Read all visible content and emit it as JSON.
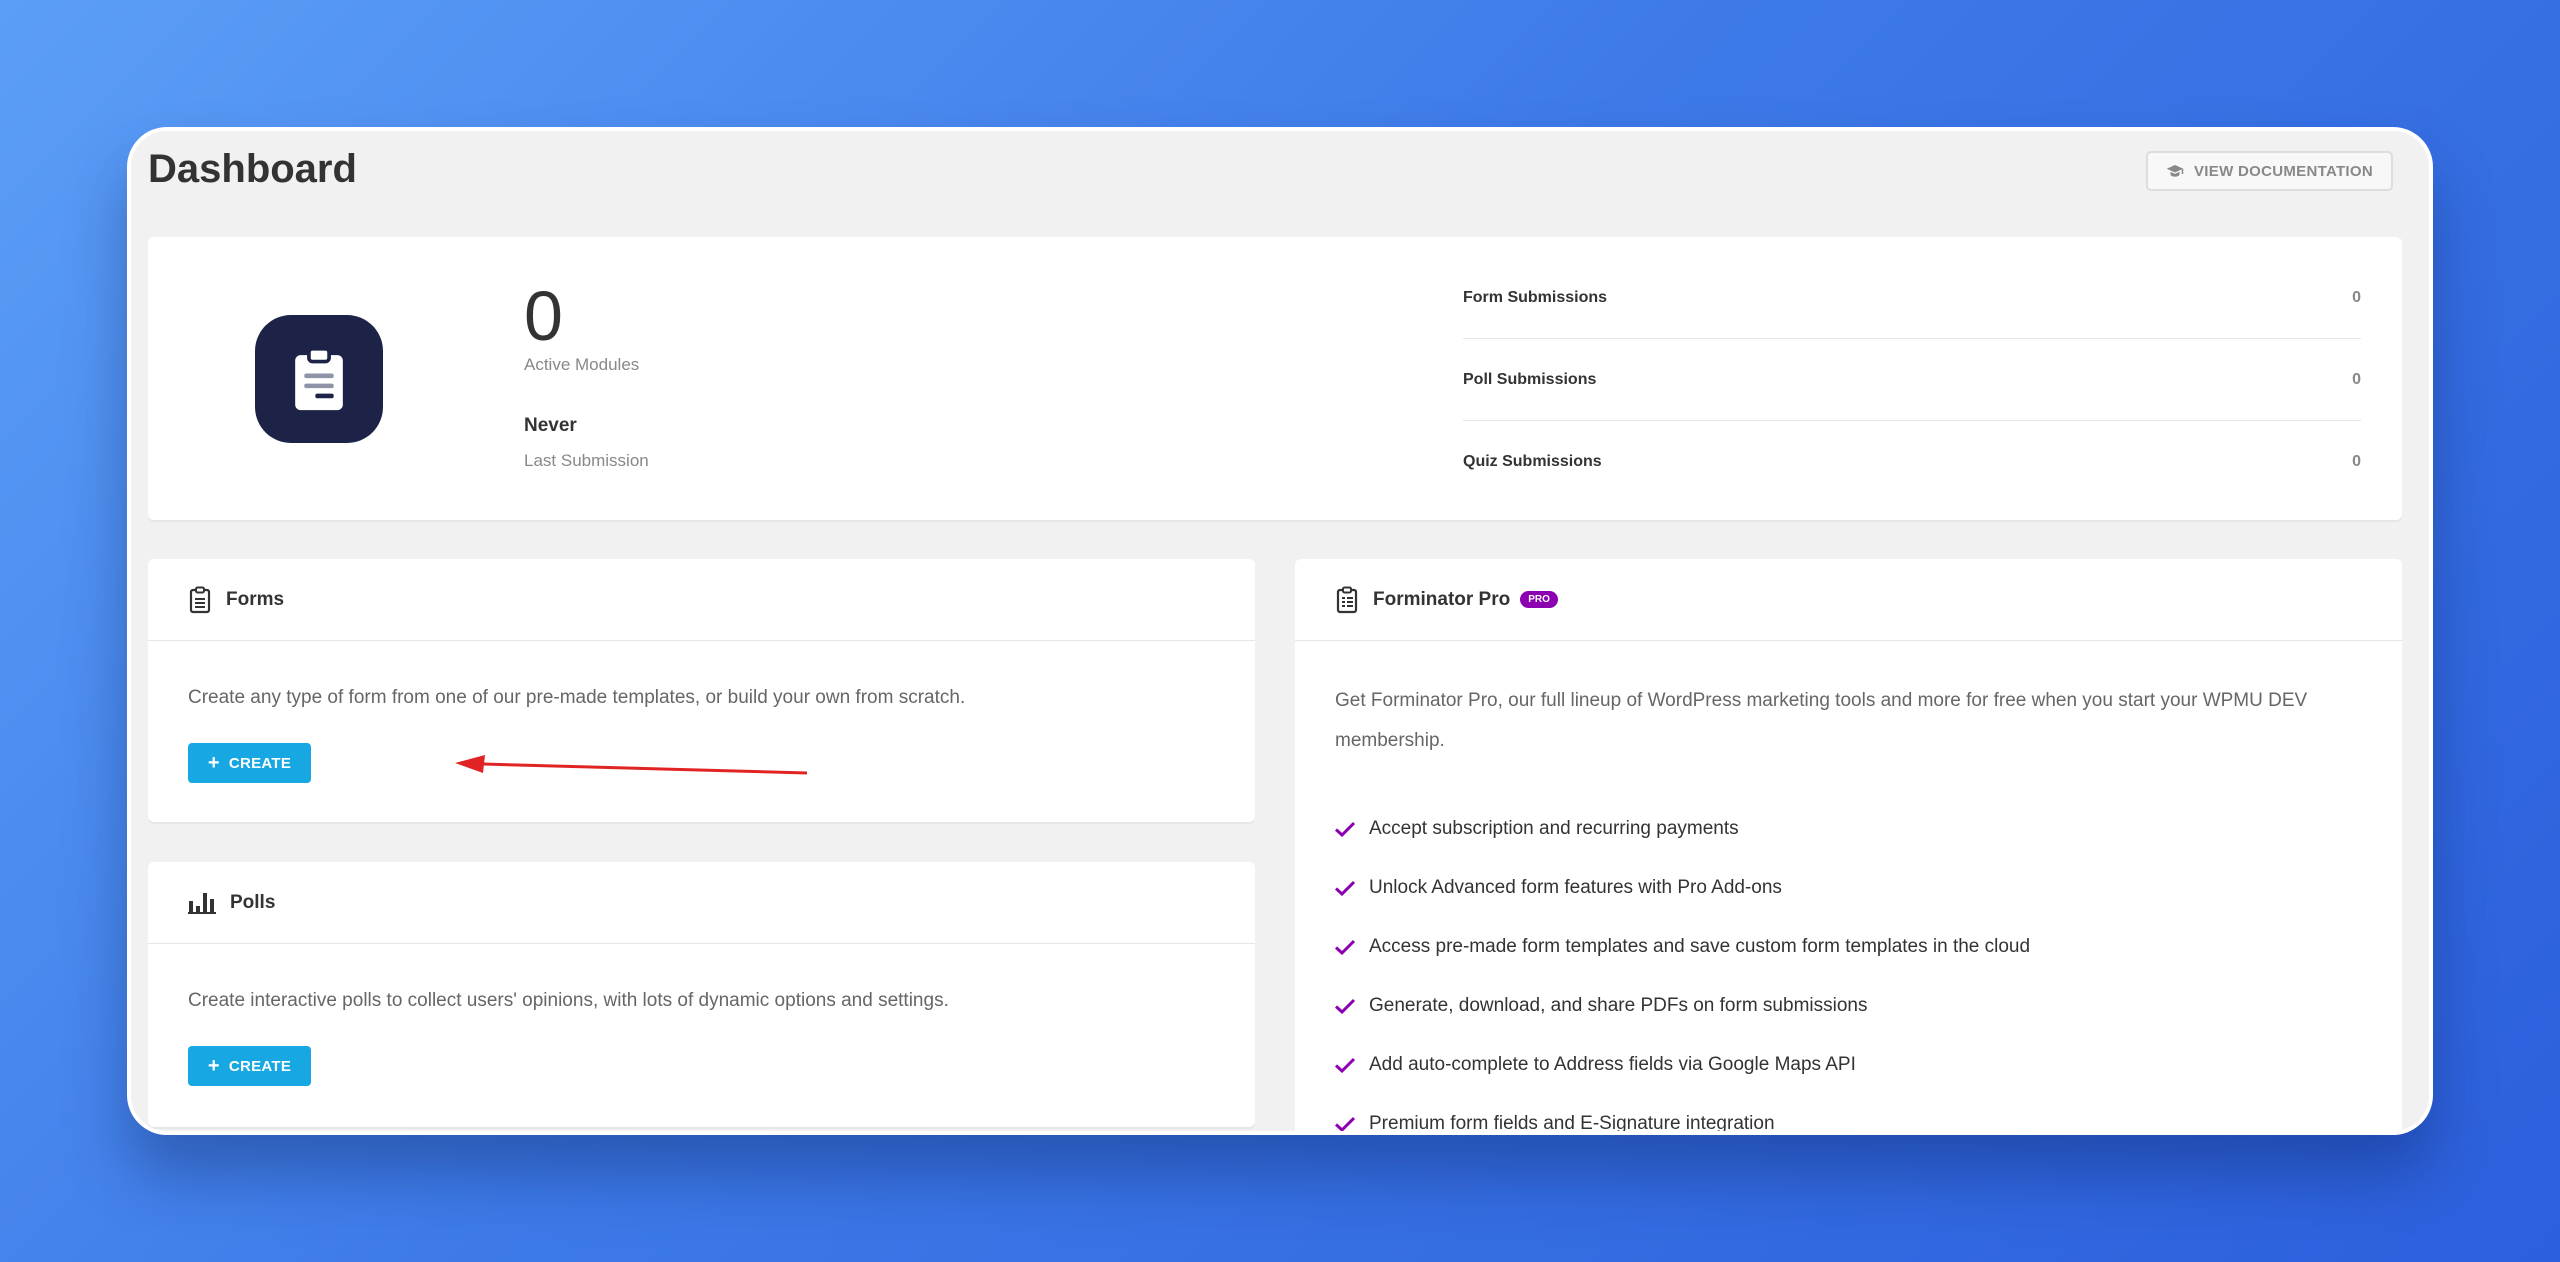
{
  "header": {
    "title": "Dashboard",
    "doc_button": "VIEW DOCUMENTATION",
    "doc_icon": "graduation-cap-icon"
  },
  "summary": {
    "icon": "clipboard-icon",
    "active_count": "0",
    "active_label": "Active Modules",
    "last_value": "Never",
    "last_label": "Last Submission",
    "stats": [
      {
        "label": "Form Submissions",
        "value": "0"
      },
      {
        "label": "Poll Submissions",
        "value": "0"
      },
      {
        "label": "Quiz Submissions",
        "value": "0"
      }
    ]
  },
  "forms": {
    "icon": "clipboard-icon",
    "title": "Forms",
    "description": "Create any type of form from one of our pre-made templates, or build your own from scratch.",
    "button": "CREATE"
  },
  "polls": {
    "icon": "bar-chart-icon",
    "title": "Polls",
    "description": "Create interactive polls to collect users' opinions, with lots of dynamic options and settings.",
    "button": "CREATE"
  },
  "pro": {
    "icon": "clipboard-list-icon",
    "title": "Forminator Pro",
    "badge": "PRO",
    "description": "Get Forminator Pro, our full lineup of WordPress marketing tools and more for free when you start your WPMU DEV membership.",
    "features": [
      "Accept subscription and recurring payments",
      "Unlock Advanced form features with Pro Add-ons",
      "Access pre-made form templates and save custom form templates in the cloud",
      "Generate, download, and share PDFs on form submissions",
      "Add auto-complete to Address fields via Google Maps API",
      "Premium form fields and E-Signature integration"
    ]
  },
  "colors": {
    "accent": "#17a8e3",
    "pro_purple": "#8d00b1",
    "icon_bg": "#1c2346",
    "annotation": "#e02424"
  }
}
